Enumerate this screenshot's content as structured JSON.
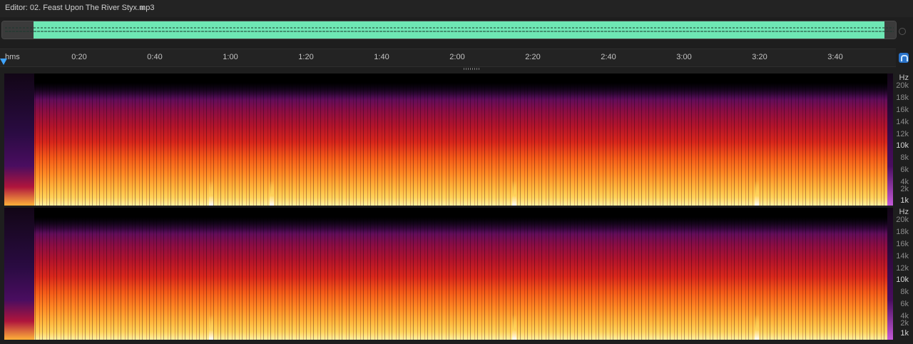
{
  "editor": {
    "title": "Editor: 02. Feast Upon The River Styx.mp3",
    "menu_icon": "hamburger-menu-icon"
  },
  "ruler": {
    "unit_label": "hms",
    "ticks": [
      "0:20",
      "0:40",
      "1:00",
      "1:20",
      "1:40",
      "2:00",
      "2:20",
      "2:40",
      "3:00",
      "3:20",
      "3:40"
    ]
  },
  "frequency_scale": {
    "unit": "Hz",
    "labels": [
      "20k",
      "18k",
      "16k",
      "14k",
      "12k",
      "10k",
      "8k",
      "6k",
      "4k",
      "2k",
      "1k"
    ]
  },
  "colors": {
    "overview_fill": "#6ee7b4",
    "playhead": "#3fa4ff",
    "snap_toggle": "#2a73c9"
  }
}
